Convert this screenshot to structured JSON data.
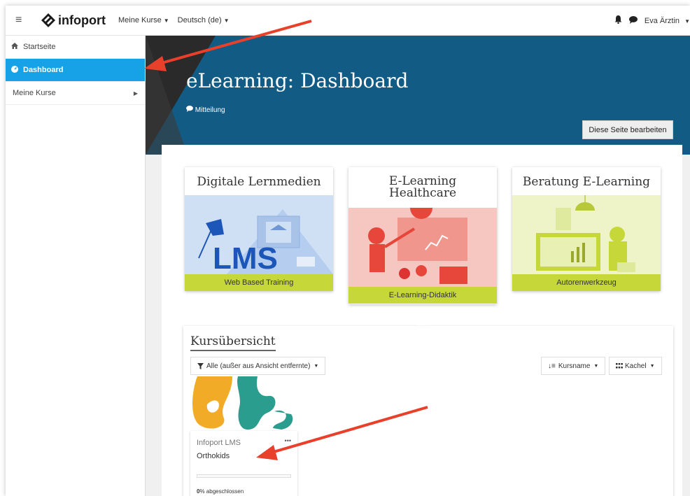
{
  "topbar": {
    "brand": "infoport",
    "menu": [
      {
        "label": "Meine Kurse"
      },
      {
        "label": "Deutsch (de)"
      }
    ],
    "user_name": "Eva Ärztin",
    "icons": [
      "menu-icon",
      "bell-icon",
      "chat-icon",
      "caret-down-icon"
    ]
  },
  "sidebar": {
    "items": [
      {
        "label": "Startseite",
        "icon": "home-icon"
      },
      {
        "label": "Dashboard",
        "icon": "dashboard-icon",
        "active": true
      },
      {
        "label": "Meine Kurse",
        "icon": "",
        "has_children": true
      }
    ]
  },
  "hero": {
    "title": "eLearning: Dashboard",
    "notice": "Mitteilung",
    "edit_button": "Diese Seite bearbeiten"
  },
  "cards": [
    {
      "title": "Digitale Lernmedien",
      "footer": "Web Based Training",
      "art_text": "LMS"
    },
    {
      "title": "E-Learning Healthcare",
      "footer": "E-Learning-Didaktik"
    },
    {
      "title": "Beratung E-Learning",
      "footer": "Autorenwerkzeug"
    }
  ],
  "overview": {
    "title": "Kursübersicht",
    "filter_label": "Alle (außer aus Ansicht entfernte)",
    "sort_label": "Kursname",
    "view_label": "Kachel",
    "courses": [
      {
        "category": "Infoport LMS",
        "name": "Orthokids",
        "progress_percent": 0,
        "progress_suffix": "% abgeschlossen",
        "more": "•••"
      }
    ]
  },
  "colors": {
    "active": "#17a2e8",
    "hero": "#125b85",
    "accent_green": "#c6d739",
    "arrow": "#e8402a"
  }
}
